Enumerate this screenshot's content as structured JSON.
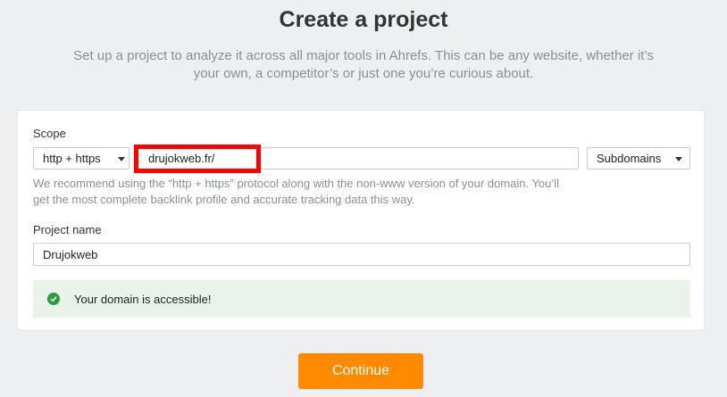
{
  "header": {
    "title": "Create a project",
    "subtitle": "Set up a project to analyze it across all major tools in Ahrefs. This can be any website, whether it’s your own, a competitor’s or just one you’re curious about."
  },
  "form": {
    "scope_label": "Scope",
    "protocol_value": "http + https",
    "url_value": "drujokweb.fr/",
    "subdomain_value": "Subdomains",
    "hint": "We recommend using the “http + https” protocol along with the non-www version of your domain. You’ll get the most complete backlink profile and accurate tracking data this way.",
    "project_name_label": "Project name",
    "project_name_value": "Drujokweb",
    "status_message": "Your domain is accessible!"
  },
  "actions": {
    "continue_label": "Continue"
  },
  "colors": {
    "accent": "#ff8a00",
    "success_bg": "#e9f3ea",
    "success_icon": "#2a9d3f",
    "highlight": "#ff0000"
  },
  "icons": {
    "dropdown": "caret-down-icon",
    "status": "check-circle-icon"
  }
}
